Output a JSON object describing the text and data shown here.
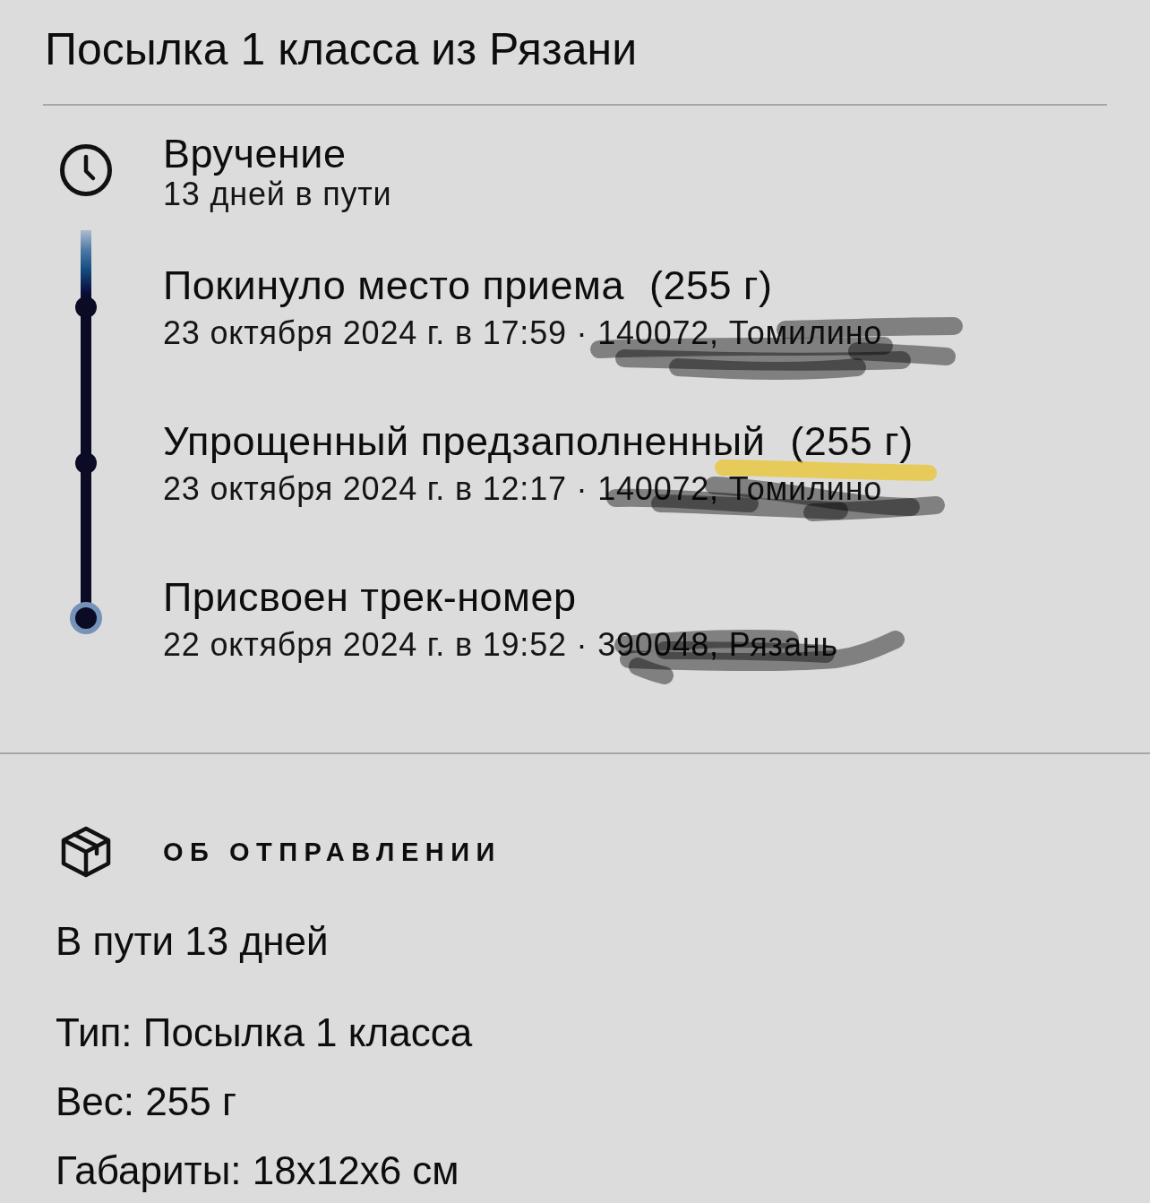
{
  "title": "Посылка 1 класса из Рязани",
  "timeline": [
    {
      "kind": "pending",
      "title": "Вручение",
      "subtitle": "13 дней в пути"
    },
    {
      "kind": "event",
      "title": "Покинуло место приема",
      "weight": "(255 г)",
      "subtitle": "23 октября 2024 г. в 17:59 · 140072, Томилино",
      "redacted": true
    },
    {
      "kind": "event",
      "title": "Упрощенный предзаполненный",
      "weight": "(255 г)",
      "subtitle": "23 октября 2024 г. в 12:17 · 140072, Томилино",
      "redacted": true
    },
    {
      "kind": "origin",
      "title": "Присвоен трек-номер",
      "subtitle": "22 октября 2024 г. в 19:52 · 390048, Рязань",
      "redacted": true
    }
  ],
  "about": {
    "heading": "ОБ ОТПРАВЛЕНИИ",
    "summary": "В пути 13 дней",
    "details": [
      "Тип: Посылка 1 класса",
      "Вес: 255 г",
      "Габариты: 18x12x6 см"
    ]
  }
}
